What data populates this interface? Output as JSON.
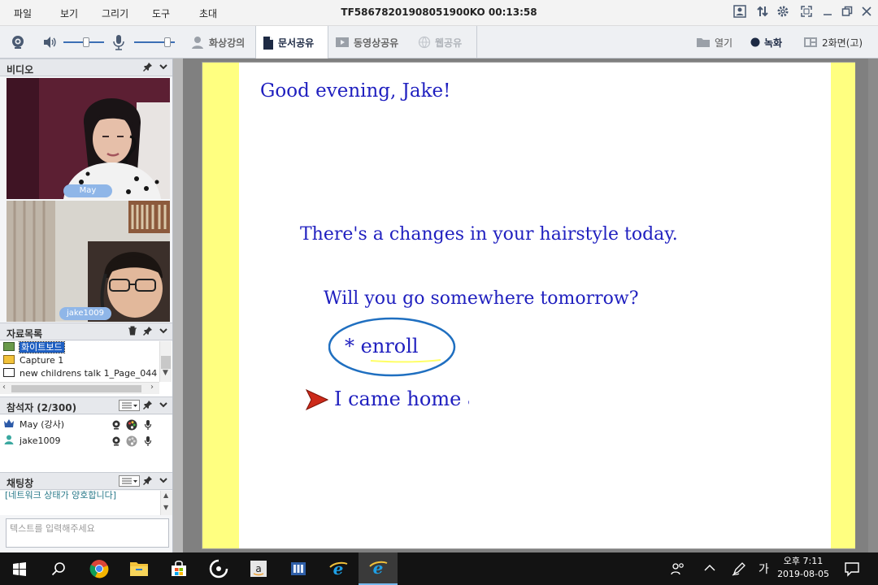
{
  "menu": [
    "파일",
    "보기",
    "그리기",
    "도구",
    "초대"
  ],
  "session_title": "TF58678201908051900KO 00:13:58",
  "toolbar": {
    "tabs": [
      {
        "label": "화상강의",
        "state": "normal"
      },
      {
        "label": "문서공유",
        "state": "active"
      },
      {
        "label": "동영상공유",
        "state": "normal"
      },
      {
        "label": "웹공유",
        "state": "disabled"
      }
    ],
    "open_label": "열기",
    "record_label": "녹화",
    "layout_label": "2화면(고)"
  },
  "video_panel": {
    "title": "비디오",
    "feeds": [
      {
        "name": "May"
      },
      {
        "name": "jake1009"
      }
    ]
  },
  "materials": {
    "title": "자료목록",
    "items": [
      {
        "label": "화이트보드",
        "selected": true
      },
      {
        "label": "Capture 1",
        "selected": false
      },
      {
        "label": "new childrens talk 1_Page_044",
        "selected": false
      }
    ]
  },
  "participants": {
    "title": "참석자 (2/300)",
    "people": [
      {
        "name": "May (강사)",
        "role": "instructor"
      },
      {
        "name": "jake1009",
        "role": "student"
      }
    ]
  },
  "chat": {
    "title": "채팅창",
    "last_message": "[네트워크 상태가 양호합니다]",
    "input_placeholder": "텍스트를 입력해주세요"
  },
  "slide": {
    "greeting": "Good evening, Jake!",
    "line1": "There's a changes in your hairstyle today.",
    "line2": "Will you go somewhere tomorrow?",
    "circled": "*  enroll",
    "line3": "I came home a"
  },
  "taskbar": {
    "time": "오후 7:11",
    "date": "2019-08-05",
    "ime": "가"
  },
  "colors": {
    "slide_text": "#1f1fbf",
    "slide_margin": "#ffff80",
    "circle_ink": "#1f6fc0"
  }
}
